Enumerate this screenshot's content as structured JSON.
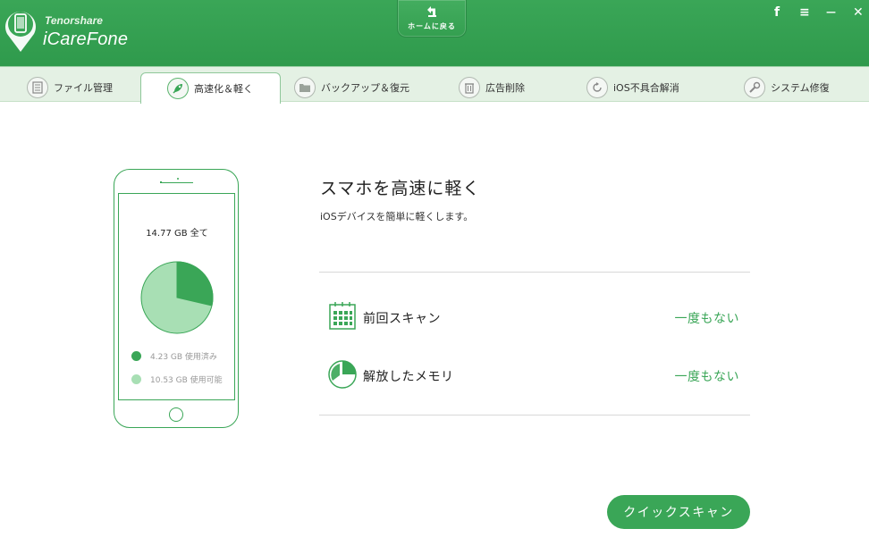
{
  "app": {
    "brand_small": "Tenorshare",
    "brand_name": "iCareFone"
  },
  "header": {
    "home_button_label": "ホームに戻る",
    "controls": {
      "facebook": "f",
      "menu": "≡",
      "minimize": "—",
      "close": "✕"
    }
  },
  "tabs": [
    {
      "label": "ファイル管理",
      "icon": "file-icon",
      "active": false
    },
    {
      "label": "高速化＆軽く",
      "icon": "rocket-icon",
      "active": true
    },
    {
      "label": "バックアップ＆復元",
      "icon": "folder-icon",
      "active": false
    },
    {
      "label": "広告削除",
      "icon": "trash-icon",
      "active": false
    },
    {
      "label": "iOS不具合解消",
      "icon": "refresh-icon",
      "active": false
    },
    {
      "label": "システム修復",
      "icon": "wrench-icon",
      "active": false
    }
  ],
  "phone": {
    "total_storage": "14.77 GB 全て",
    "used_label": "4.23 GB 使用済み",
    "available_label": "10.53 GB 使用可能",
    "used_fraction": 0.286
  },
  "main": {
    "title": "スマホを高速に軽く",
    "subtitle": "iOSデバイスを簡単に軽くします。",
    "rows": [
      {
        "label": "前回スキャン",
        "value": "一度もない",
        "icon": "calendar-icon"
      },
      {
        "label": "解放したメモリ",
        "value": "一度もない",
        "icon": "pie-chart-icon"
      }
    ],
    "scan_button": "クイックスキャン"
  },
  "colors": {
    "accent": "#3aa657",
    "accent_light": "#a8dfb4",
    "tab_bg": "#e4f1e4"
  }
}
